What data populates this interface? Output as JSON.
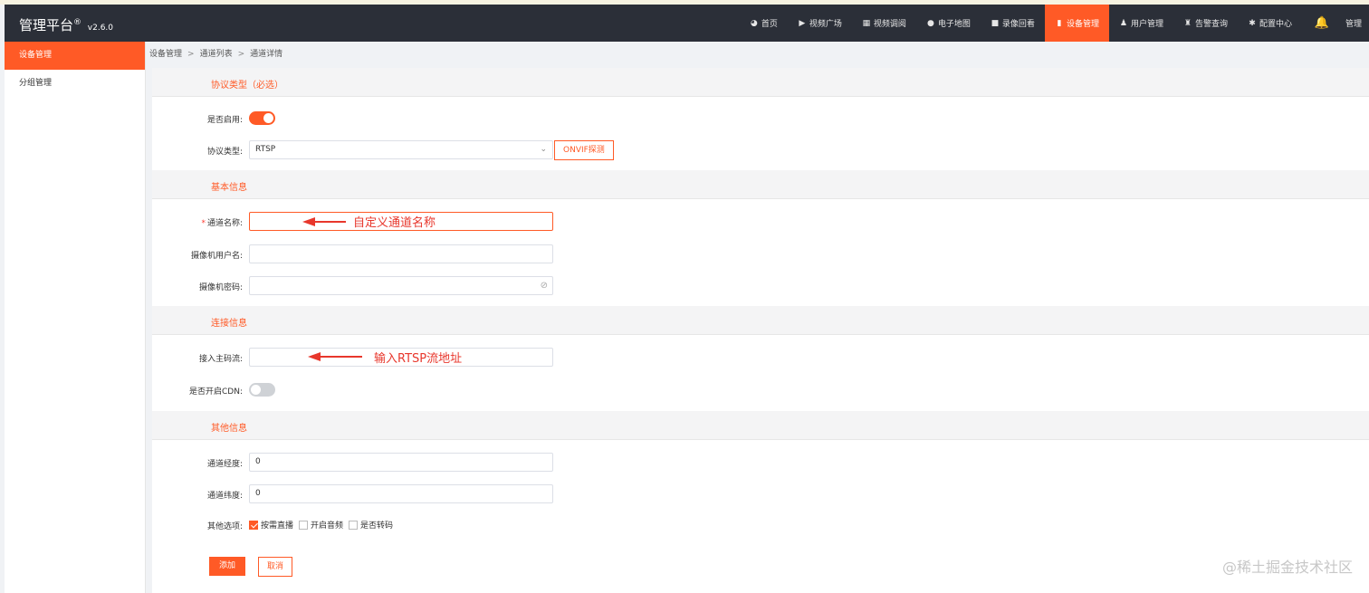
{
  "app": {
    "title": "管理平台",
    "registered": "®",
    "version": "v2.6.0"
  },
  "nav": {
    "items": [
      {
        "label": "首页",
        "icon": "dashboard-icon",
        "glyph": "◕"
      },
      {
        "label": "视频广场",
        "icon": "play-circle-icon",
        "glyph": "▶"
      },
      {
        "label": "视频调阅",
        "icon": "table-icon",
        "glyph": "▦"
      },
      {
        "label": "电子地图",
        "icon": "map-marker-icon",
        "glyph": "●"
      },
      {
        "label": "录像回看",
        "icon": "video-camera-icon",
        "glyph": "■"
      },
      {
        "label": "设备管理",
        "icon": "device-icon",
        "glyph": "▮"
      },
      {
        "label": "用户管理",
        "icon": "user-icon",
        "glyph": "♟"
      },
      {
        "label": "告警查询",
        "icon": "alarm-icon",
        "glyph": "♜"
      },
      {
        "label": "配置中心",
        "icon": "gear-icon",
        "glyph": "✱"
      }
    ],
    "active_index": 5,
    "admin_label": "管理"
  },
  "sidebar": {
    "items": [
      {
        "label": "设备管理"
      },
      {
        "label": "分组管理"
      }
    ]
  },
  "breadcrumb": [
    "设备管理",
    "通道列表",
    "通道详情"
  ],
  "breadcrumb_sep": ">",
  "sections": {
    "protocol": "协议类型（必选）",
    "basic": "基本信息",
    "connection": "连接信息",
    "other": "其他信息"
  },
  "form": {
    "enabled_label": "是否启用:",
    "enabled": true,
    "protocol_label": "协议类型:",
    "protocol_value": "RTSP",
    "onvif_button": "ONVIF探测",
    "required_mark": "*",
    "channel_name_label": "通道名称:",
    "channel_name_value": "",
    "camera_user_label": "摄像机用户名:",
    "camera_user_value": "",
    "camera_password_label": "摄像机密码:",
    "camera_password_value": "",
    "main_stream_label": "接入主码流:",
    "main_stream_value": "",
    "cdn_label": "是否开启CDN:",
    "cdn_enabled": false,
    "longitude_label": "通道经度:",
    "longitude_value": "0",
    "latitude_label": "通道纬度:",
    "latitude_value": "0",
    "options_label": "其他选项:",
    "options": [
      {
        "label": "按需直播",
        "checked": true
      },
      {
        "label": "开启音频",
        "checked": false
      },
      {
        "label": "是否转码",
        "checked": false
      }
    ],
    "add_button": "添加",
    "cancel_button": "取消"
  },
  "annotations": {
    "channel_name_hint": "自定义通道名称",
    "rtsp_hint": "输入RTSP流地址",
    "color": "#e8372c"
  },
  "watermark": "@稀土掘金技术社区",
  "colors": {
    "accent": "#ff5a26",
    "topbar": "#2b2f38"
  }
}
